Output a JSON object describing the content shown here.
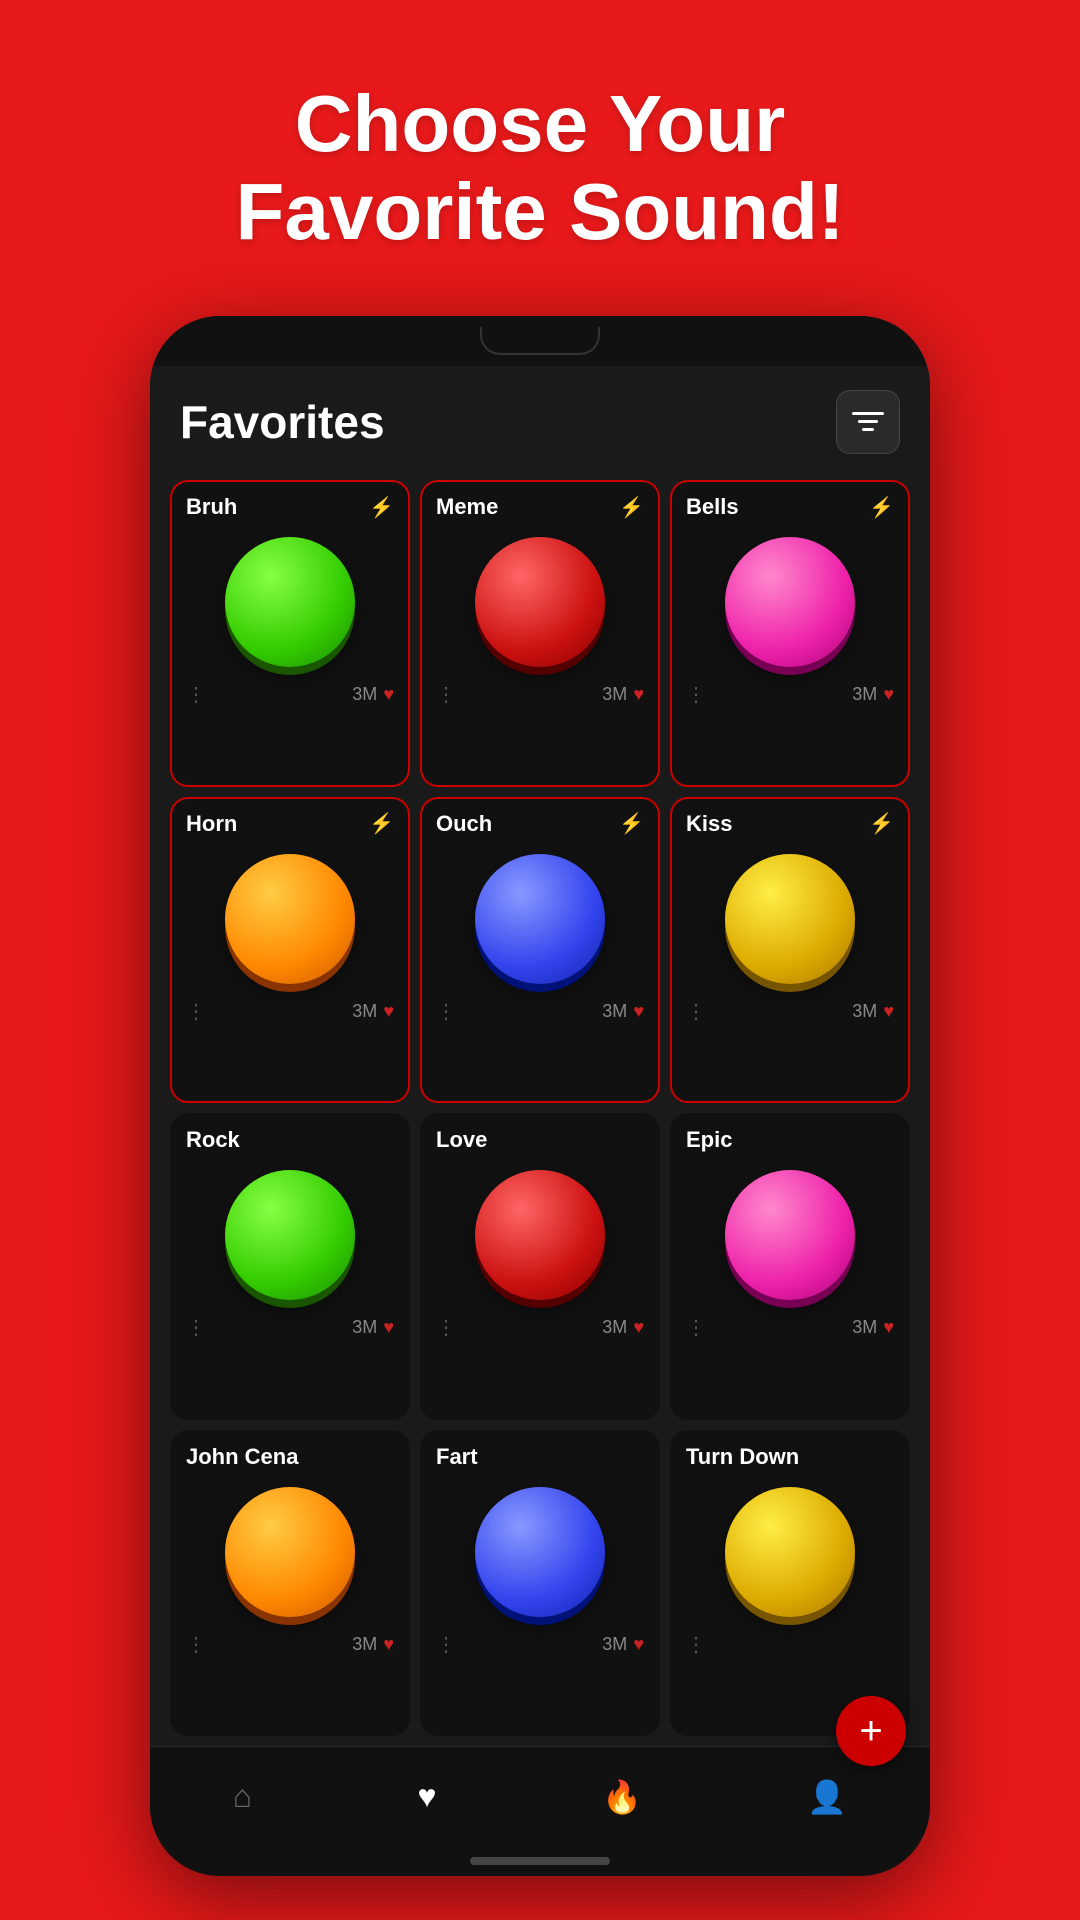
{
  "header": {
    "line1": "Choose Your",
    "line2": "Favorite Sound!"
  },
  "app": {
    "title": "Favorites",
    "filter_icon": "≡"
  },
  "sounds": [
    {
      "id": "bruh",
      "name": "Bruh",
      "color": "btn-green",
      "stats": "3M",
      "active": true
    },
    {
      "id": "meme",
      "name": "Meme",
      "color": "btn-red",
      "stats": "3M",
      "active": true
    },
    {
      "id": "bells",
      "name": "Bells",
      "color": "btn-pink",
      "stats": "3M",
      "active": true
    },
    {
      "id": "horn",
      "name": "Horn",
      "color": "btn-orange",
      "stats": "3M",
      "active": true
    },
    {
      "id": "ouch",
      "name": "Ouch",
      "color": "btn-blue",
      "stats": "3M",
      "active": true
    },
    {
      "id": "kiss",
      "name": "Kiss",
      "color": "btn-yellow",
      "stats": "3M",
      "active": true
    },
    {
      "id": "rock",
      "name": "Rock",
      "color": "btn-green",
      "stats": "3M",
      "active": false
    },
    {
      "id": "love",
      "name": "Love",
      "color": "btn-red",
      "stats": "3M",
      "active": false
    },
    {
      "id": "epic",
      "name": "Epic",
      "color": "btn-pink",
      "stats": "3M",
      "active": false
    },
    {
      "id": "john-cena",
      "name": "John Cena",
      "color": "btn-orange",
      "stats": "3M",
      "active": false
    },
    {
      "id": "fart",
      "name": "Fart",
      "color": "btn-blue",
      "stats": "3M",
      "active": false
    },
    {
      "id": "turn-down",
      "name": "Turn Down",
      "color": "btn-yellow",
      "stats": "",
      "active": false
    }
  ],
  "nav": {
    "items": [
      {
        "id": "home",
        "icon": "⌂",
        "active": false
      },
      {
        "id": "favorites",
        "icon": "♥",
        "active": true
      },
      {
        "id": "trending",
        "icon": "🔥",
        "active": false
      },
      {
        "id": "profile",
        "icon": "👤",
        "active": false
      }
    ]
  },
  "fab": {
    "label": "+"
  }
}
